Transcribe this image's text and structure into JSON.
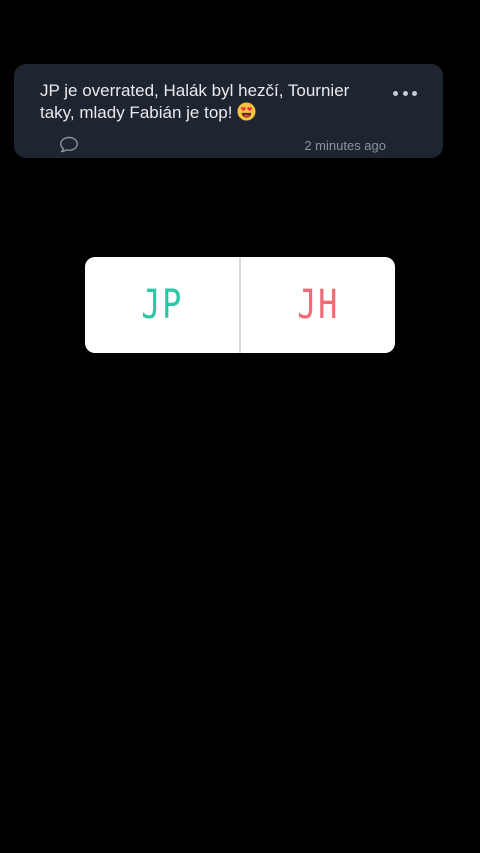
{
  "comment": {
    "text": "JP je overrated, Halák byl hezčí, Tournier taky, mlady Fabián je top!",
    "emoji_icon": "heart-eyes-emoji-icon",
    "timestamp": "2 minutes ago",
    "more_icon": "more-horizontal-icon",
    "reply_icon": "speech-bubble-icon"
  },
  "poll": {
    "options": [
      {
        "label": "JP",
        "color": "#2dc5a5"
      },
      {
        "label": "JH",
        "color": "#ee6b76"
      }
    ]
  },
  "colors": {
    "background": "#000000",
    "card": "#1e2530",
    "text": "#e8eaed",
    "muted": "#8c929b"
  }
}
